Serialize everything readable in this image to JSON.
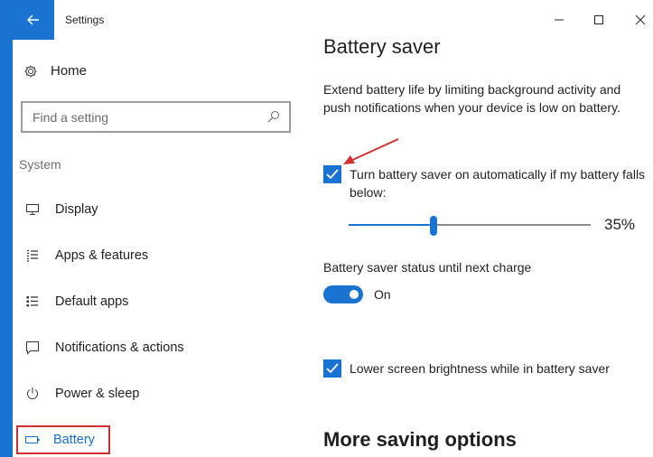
{
  "window": {
    "title": "Settings"
  },
  "sidebar": {
    "home_label": "Home",
    "search": {
      "placeholder": "Find a setting"
    },
    "section_label": "System",
    "items": [
      {
        "label": "Display",
        "icon": "monitor-icon"
      },
      {
        "label": "Apps & features",
        "icon": "list-icon"
      },
      {
        "label": "Default apps",
        "icon": "default-apps-icon"
      },
      {
        "label": "Notifications & actions",
        "icon": "message-icon"
      },
      {
        "label": "Power & sleep",
        "icon": "power-icon"
      },
      {
        "label": "Battery",
        "icon": "battery-icon",
        "selected": true,
        "highlight_color": "#d0312d"
      }
    ]
  },
  "main": {
    "title": "Battery saver",
    "description": "Extend battery life by limiting background activity and push notifications when your device is low on battery.",
    "auto_checkbox": {
      "label": "Turn battery saver on automatically if my battery falls below:",
      "checked": true
    },
    "threshold": {
      "value": 35,
      "display": "35%"
    },
    "status": {
      "label": "Battery saver status until next charge",
      "toggle_on": true,
      "toggle_label": "On"
    },
    "brightness_checkbox": {
      "label": "Lower screen brightness while in battery saver",
      "checked": true
    },
    "more_title": "More saving options"
  },
  "colors": {
    "accent": "#1a73d1",
    "annotation": "#d0312d"
  }
}
